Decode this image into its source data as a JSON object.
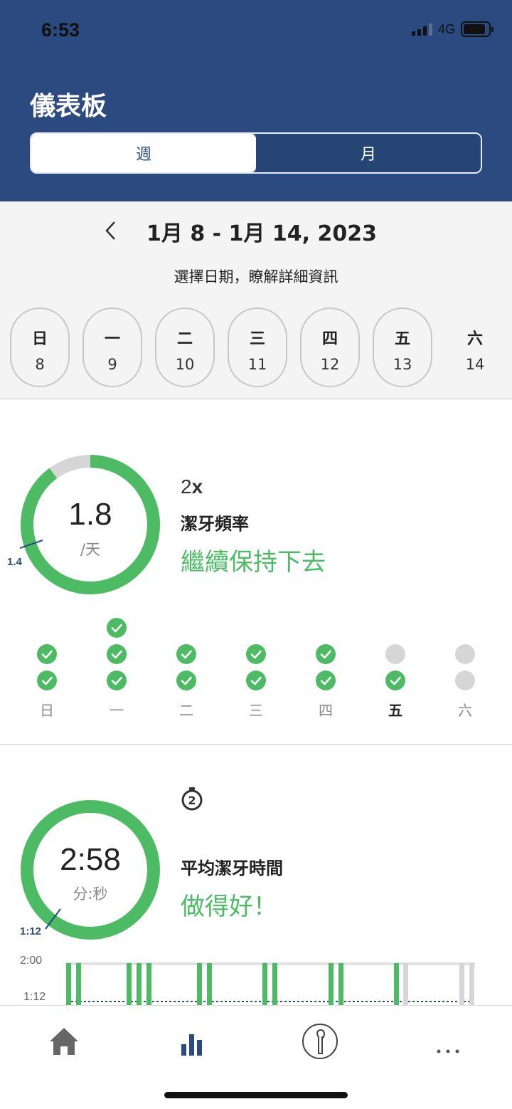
{
  "status": {
    "time": "6:53",
    "network": "4G"
  },
  "header": {
    "title": "儀表板"
  },
  "segment": {
    "week": "週",
    "month": "月"
  },
  "week_nav": {
    "prev_icon": "chevron-left-icon",
    "range": "1月 8 - 1月 14, 2023",
    "hint": "選擇日期，瞭解詳細資訊"
  },
  "days": [
    {
      "name": "日",
      "date": "8"
    },
    {
      "name": "一",
      "date": "9"
    },
    {
      "name": "二",
      "date": "10"
    },
    {
      "name": "三",
      "date": "11"
    },
    {
      "name": "四",
      "date": "12"
    },
    {
      "name": "五",
      "date": "13"
    },
    {
      "name": "六",
      "date": "14"
    }
  ],
  "frequency": {
    "value": "1.8",
    "unit": "/天",
    "average_mark": "1.4",
    "goal_number": "2",
    "goal_suffix": "x",
    "title": "潔牙頻率",
    "message": "繼續保持下去",
    "progress_fraction": 0.9,
    "day_labels": [
      "日",
      "一",
      "二",
      "三",
      "四",
      "五",
      "六"
    ],
    "sessions_done": [
      2,
      3,
      2,
      2,
      2,
      1,
      0
    ],
    "sessions_slots": [
      2,
      3,
      2,
      2,
      2,
      2,
      2
    ]
  },
  "duration": {
    "value": "2:58",
    "unit": "分:秒",
    "average_mark": "1:12",
    "title": "平均潔牙時間",
    "message": "做得好！",
    "y_labels": [
      "2:00",
      "1:12"
    ]
  },
  "colors": {
    "brand": "#2b4a80",
    "good": "#4cbb63",
    "empty": "#d6d6d6"
  },
  "tabs": [
    "home-icon",
    "dashboard-icon",
    "brush-head-icon",
    "more-icon"
  ]
}
